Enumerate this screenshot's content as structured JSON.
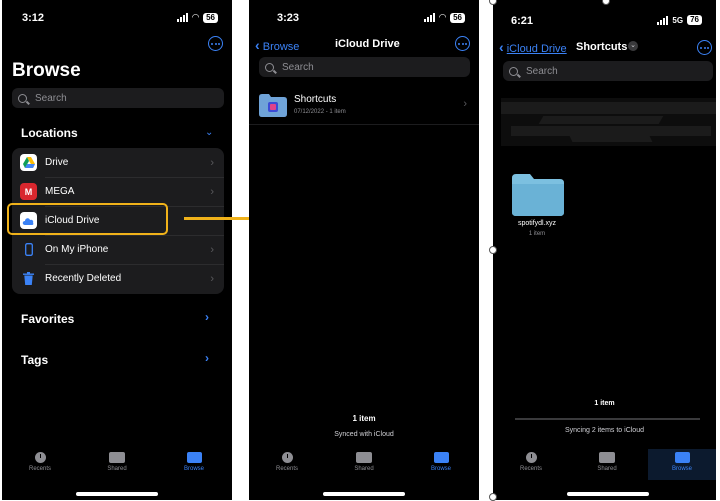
{
  "panel1": {
    "time": "3:12",
    "battery": "56",
    "title": "Browse",
    "search_placeholder": "Search",
    "locations_label": "Locations",
    "locations": [
      {
        "label": "Drive",
        "icon": "google-drive-icon"
      },
      {
        "label": "MEGA",
        "icon": "mega-icon"
      },
      {
        "label": "iCloud Drive",
        "icon": "icloud-icon"
      },
      {
        "label": "On My iPhone",
        "icon": "iphone-icon"
      },
      {
        "label": "Recently Deleted",
        "icon": "trash-icon"
      }
    ],
    "favorites_label": "Favorites",
    "tags_label": "Tags",
    "tabs": [
      "Recents",
      "Shared",
      "Browse"
    ]
  },
  "panel2": {
    "time": "3:23",
    "battery": "56",
    "back_label": "Browse",
    "title": "iCloud Drive",
    "search_placeholder": "Search",
    "folder": {
      "name": "Shortcuts",
      "meta": "07/12/2022 - 1 item"
    },
    "count": "1 item",
    "status": "Synced with iCloud",
    "tabs": [
      "Recents",
      "Shared",
      "Browse"
    ]
  },
  "panel3": {
    "time": "6:21",
    "network": "5G",
    "battery": "76",
    "back_label": "iCloud Drive",
    "title": "Shortcuts",
    "search_placeholder": "Search",
    "folder": {
      "name": "spotifydl.xyz",
      "meta": "1 item"
    },
    "count": "1 item",
    "status": "Syncing 2 items to iCloud",
    "tabs": [
      "Recents",
      "Shared",
      "Browse"
    ]
  },
  "colors": {
    "accent": "#3b82f6",
    "highlight": "#f0b21a",
    "background": "#000000",
    "row_background": "#1c1c1e"
  }
}
